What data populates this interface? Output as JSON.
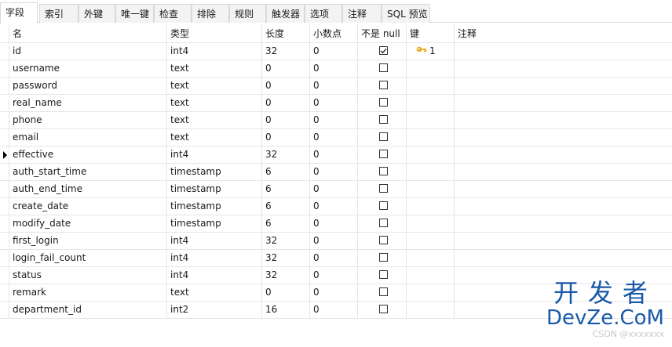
{
  "tabs": [
    {
      "label": "字段",
      "active": true
    },
    {
      "label": "索引"
    },
    {
      "label": "外键"
    },
    {
      "label": "唯一键"
    },
    {
      "label": "检查"
    },
    {
      "label": "排除"
    },
    {
      "label": "规则"
    },
    {
      "label": "触发器"
    },
    {
      "label": "选项"
    },
    {
      "label": "注释"
    },
    {
      "label": "SQL 预览"
    }
  ],
  "columns": [
    "名",
    "类型",
    "长度",
    "小数点",
    "不是 null",
    "键",
    "注释"
  ],
  "rows": [
    {
      "name": "id",
      "type": "int4",
      "length": "32",
      "decimals": "0",
      "not_null": true,
      "key": "1"
    },
    {
      "name": "username",
      "type": "text",
      "length": "0",
      "decimals": "0",
      "not_null": false,
      "key": ""
    },
    {
      "name": "password",
      "type": "text",
      "length": "0",
      "decimals": "0",
      "not_null": false,
      "key": ""
    },
    {
      "name": "real_name",
      "type": "text",
      "length": "0",
      "decimals": "0",
      "not_null": false,
      "key": ""
    },
    {
      "name": "phone",
      "type": "text",
      "length": "0",
      "decimals": "0",
      "not_null": false,
      "key": ""
    },
    {
      "name": "email",
      "type": "text",
      "length": "0",
      "decimals": "0",
      "not_null": false,
      "key": ""
    },
    {
      "name": "effective",
      "type": "int4",
      "length": "32",
      "decimals": "0",
      "not_null": false,
      "key": "",
      "current": true
    },
    {
      "name": "auth_start_time",
      "type": "timestamp",
      "length": "6",
      "decimals": "0",
      "not_null": false,
      "key": ""
    },
    {
      "name": "auth_end_time",
      "type": "timestamp",
      "length": "6",
      "decimals": "0",
      "not_null": false,
      "key": ""
    },
    {
      "name": "create_date",
      "type": "timestamp",
      "length": "6",
      "decimals": "0",
      "not_null": false,
      "key": ""
    },
    {
      "name": "modify_date",
      "type": "timestamp",
      "length": "6",
      "decimals": "0",
      "not_null": false,
      "key": ""
    },
    {
      "name": "first_login",
      "type": "int4",
      "length": "32",
      "decimals": "0",
      "not_null": false,
      "key": ""
    },
    {
      "name": "login_fail_count",
      "type": "int4",
      "length": "32",
      "decimals": "0",
      "not_null": false,
      "key": ""
    },
    {
      "name": "status",
      "type": "int4",
      "length": "32",
      "decimals": "0",
      "not_null": false,
      "key": ""
    },
    {
      "name": "remark",
      "type": "text",
      "length": "0",
      "decimals": "0",
      "not_null": false,
      "key": ""
    },
    {
      "name": "department_id",
      "type": "int2",
      "length": "16",
      "decimals": "0",
      "not_null": false,
      "key": ""
    }
  ],
  "watermark": {
    "cn": "开发者",
    "en": "DevZe.CoM",
    "url": "CSDN @xxxxxxx"
  },
  "colors": {
    "key_icon": "#e8b02f",
    "watermark": "#1a59a9"
  }
}
